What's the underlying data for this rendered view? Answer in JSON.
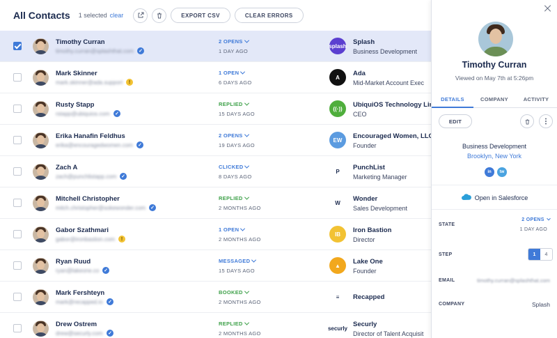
{
  "header": {
    "title": "All Contacts",
    "selected_count": "1 selected",
    "clear_label": "clear",
    "export_label": "EXPORT CSV",
    "clear_errors_label": "CLEAR ERRORS",
    "icons": [
      "external-link-icon",
      "trash-icon"
    ]
  },
  "contacts": [
    {
      "name": "Timothy Curran",
      "email": "timothy.curran@splashthat.com",
      "verify": "verified",
      "status": "2 OPENS",
      "status_color": "#3f7ad8",
      "when": "1 DAY AGO",
      "company": "Splash",
      "title": "Business Development",
      "logo_text": "splash",
      "logo_bg": "#5b3fd0",
      "selected": true
    },
    {
      "name": "Mark Skinner",
      "email": "mark.skinner@ada.support",
      "verify": "warning",
      "status": "1 OPEN",
      "status_color": "#3f7ad8",
      "when": "6 DAYS AGO",
      "company": "Ada",
      "title": "Mid-Market Account Exec",
      "logo_text": "A",
      "logo_bg": "#111111",
      "selected": false
    },
    {
      "name": "Rusty Stapp",
      "email": "rstapp@ubiquios.com",
      "verify": "verified",
      "status": "REPLIED",
      "status_color": "#3fa14a",
      "when": "15 DAYS AGO",
      "company": "UbiquiOS Technology Lin",
      "title": "CEO",
      "logo_text": "((·))",
      "logo_bg": "#4fae3c",
      "selected": false
    },
    {
      "name": "Erika Hanafin Feldhus",
      "email": "erika@encouragedwomen.com",
      "verify": "verified",
      "status": "2 OPENS",
      "status_color": "#3f7ad8",
      "when": "19 DAYS AGO",
      "company": "Encouraged Women, LLC",
      "title": "Founder",
      "logo_text": "EW",
      "logo_bg": "#5b9be0",
      "selected": false
    },
    {
      "name": "Zach A",
      "email": "zach@punchlistapp.com",
      "verify": "verified",
      "status": "CLICKED",
      "status_color": "#3f7ad8",
      "when": "8 DAYS AGO",
      "company": "PunchList",
      "title": "Marketing Manager",
      "logo_text": "P",
      "logo_bg": "#ffffff",
      "selected": false
    },
    {
      "name": "Mitchell Christopher",
      "email": "mitch.christopher@sokewonder.com",
      "verify": "verified",
      "status": "REPLIED",
      "status_color": "#3fa14a",
      "when": "2 MONTHS AGO",
      "company": "Wonder",
      "title": "Sales Development",
      "logo_text": "W",
      "logo_bg": "#ffffff",
      "selected": false
    },
    {
      "name": "Gabor Szathmari",
      "email": "gabor@ironbastion.com",
      "verify": "warning",
      "status": "1 OPEN",
      "status_color": "#3f7ad8",
      "when": "2 MONTHS AGO",
      "company": "Iron Bastion",
      "title": "Director",
      "logo_text": "IB",
      "logo_bg": "#f2c233",
      "selected": false
    },
    {
      "name": "Ryan Ruud",
      "email": "ryan@lakeone.co",
      "verify": "verified",
      "status": "MESSAGED",
      "status_color": "#3f7ad8",
      "when": "15 DAYS AGO",
      "company": "Lake One",
      "title": "Founder",
      "logo_text": "▲",
      "logo_bg": "#f2a81d",
      "selected": false
    },
    {
      "name": "Mark Fershteyn",
      "email": "mark@recapped.io",
      "verify": "verified",
      "status": "BOOKED",
      "status_color": "#3fa14a",
      "when": "2 MONTHS AGO",
      "company": "Recapped",
      "title": "",
      "logo_text": "≡",
      "logo_bg": "#ffffff",
      "selected": false
    },
    {
      "name": "Drew Ostrem",
      "email": "drew@securly.com",
      "verify": "verified",
      "status": "REPLIED",
      "status_color": "#3fa14a",
      "when": "2 MONTHS AGO",
      "company": "Securly",
      "title": "Director of Talent Acquisit",
      "logo_text": "securly",
      "logo_bg": "#ffffff",
      "selected": false
    }
  ],
  "panel": {
    "name": "Timothy Curran",
    "viewed": "Viewed on May 7th at 5:26pm",
    "tabs": [
      "DETAILS",
      "COMPANY",
      "ACTIVITY"
    ],
    "edit_label": "EDIT",
    "department": "Business Development",
    "location": "Brooklyn, New York",
    "socials": [
      "in",
      "tw"
    ],
    "salesforce_label": "Open in Salesforce",
    "state_label": "STATE",
    "state_status": "2 OPENS",
    "state_when": "1 DAY AGO",
    "step_label": "STEP",
    "step_current": "1",
    "step_total": "4",
    "email_label": "EMAIL",
    "email_value": "timothy.curran@splashthat.com",
    "company_label": "COMPANY",
    "company_value": "Splash"
  },
  "colors": {
    "accent": "#3f7ad8",
    "selected_row": "#e3e8f8",
    "replied": "#3fa14a",
    "warning": "#f2c233"
  }
}
